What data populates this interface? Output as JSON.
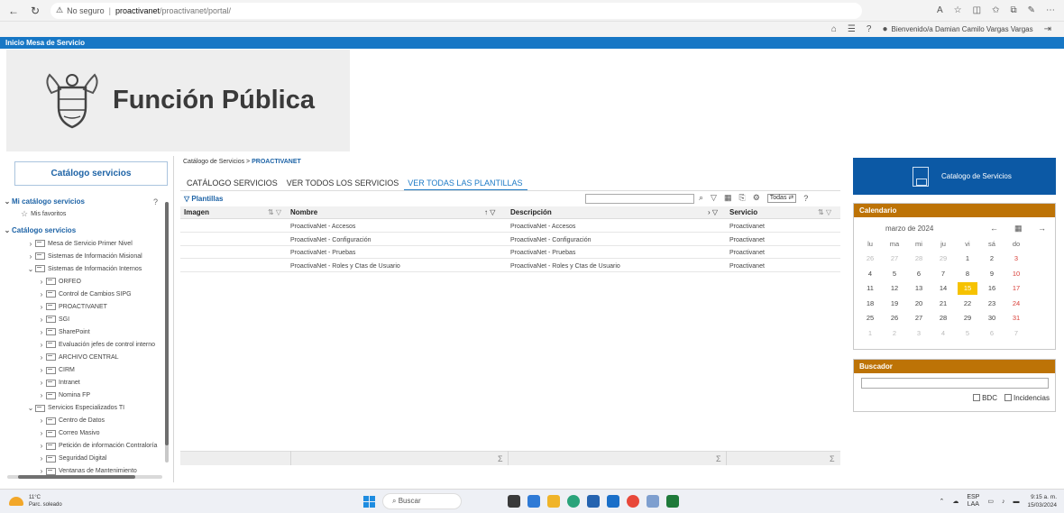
{
  "browser": {
    "security_label": "No seguro",
    "url_host": "proactivanet",
    "url_path": "/proactivanet/portal/",
    "separator": "|"
  },
  "header": {
    "welcome": "Bienvenido/a Damian Camilo Vargas Vargas",
    "bar_title": "Inicio Mesa de Servicio",
    "logo_text": "Función Pública"
  },
  "sidebar": {
    "title": "Catálogo servicios",
    "my_catalog": "Mi catálogo servicios",
    "favorites": "Mis favoritos",
    "catalog": "Catálogo servicios",
    "items": [
      {
        "label": "Mesa de Servicio Primer Nivel"
      },
      {
        "label": "Sistemas de Información Misional"
      },
      {
        "label": "Sistemas de Información Internos"
      },
      {
        "label": "ORFEO"
      },
      {
        "label": "Control de Cambios SIPG"
      },
      {
        "label": "PROACTIVANET"
      },
      {
        "label": "SGI"
      },
      {
        "label": "SharePoint"
      },
      {
        "label": "Evaluación jefes de control interno"
      },
      {
        "label": "ARCHIVO CENTRAL"
      },
      {
        "label": "CIRM"
      },
      {
        "label": "Intranet"
      },
      {
        "label": "Nomina FP"
      },
      {
        "label": "Servicios Especializados TI"
      },
      {
        "label": "Centro de Datos"
      },
      {
        "label": "Correo Masivo"
      },
      {
        "label": "Petición de información Contraloría"
      },
      {
        "label": "Seguridad Digital"
      },
      {
        "label": "Ventanas de Mantenimiento"
      }
    ]
  },
  "breadcrumb": {
    "root": "Catálogo de Servicios",
    "sep": ">",
    "current": "PROACTIVANET"
  },
  "tabs": [
    {
      "label": "CATÁLOGO SERVICIOS"
    },
    {
      "label": "VER TODOS LOS SERVICIOS"
    },
    {
      "label": "VER TODAS LAS PLANTILLAS"
    }
  ],
  "grid": {
    "filter_title": "Plantillas",
    "todas_label": "Todas",
    "columns": {
      "imagen": "Imagen",
      "nombre": "Nombre",
      "descripcion": "Descripción",
      "servicio": "Servicio"
    },
    "rows": [
      {
        "nombre": "ProactivaNet - Accesos",
        "descripcion": "ProactivaNet - Accesos",
        "servicio": "Proactivanet"
      },
      {
        "nombre": "ProactivaNet - Configuración",
        "descripcion": "ProactivaNet - Configuración",
        "servicio": "Proactivanet"
      },
      {
        "nombre": "ProactivaNet - Pruebas",
        "descripcion": "ProactivaNet - Pruebas",
        "servicio": "Proactivanet"
      },
      {
        "nombre": "ProactivaNet - Roles y Ctas de Usuario",
        "descripcion": "ProactivaNet - Roles y Ctas de Usuario",
        "servicio": "Proactivanet"
      }
    ],
    "sigma": "Σ"
  },
  "service_tile": {
    "label": "Catalogo de Servicios"
  },
  "calendar": {
    "title": "Calendario",
    "month": "marzo de 2024",
    "prev": "←",
    "next": "→",
    "dow": [
      "lu",
      "ma",
      "mi",
      "ju",
      "vi",
      "sá",
      "do"
    ],
    "weeks": [
      [
        "26",
        "27",
        "28",
        "29",
        "1",
        "2",
        "3"
      ],
      [
        "4",
        "5",
        "6",
        "7",
        "8",
        "9",
        "10"
      ],
      [
        "11",
        "12",
        "13",
        "14",
        "15",
        "16",
        "17"
      ],
      [
        "18",
        "19",
        "20",
        "21",
        "22",
        "23",
        "24"
      ],
      [
        "25",
        "26",
        "27",
        "28",
        "29",
        "30",
        "31"
      ],
      [
        "1",
        "2",
        "3",
        "4",
        "5",
        "6",
        "7"
      ]
    ],
    "today": "15"
  },
  "finder": {
    "title": "Buscador",
    "opt_bdc": "BDC",
    "opt_incidencias": "Incidencias"
  },
  "taskbar": {
    "temp": "11°C",
    "weather": "Parc. soleado",
    "search": "Buscar",
    "lang": "ESP",
    "lang2": "LAA",
    "time": "9:15 a. m.",
    "date": "15/03/2024"
  }
}
